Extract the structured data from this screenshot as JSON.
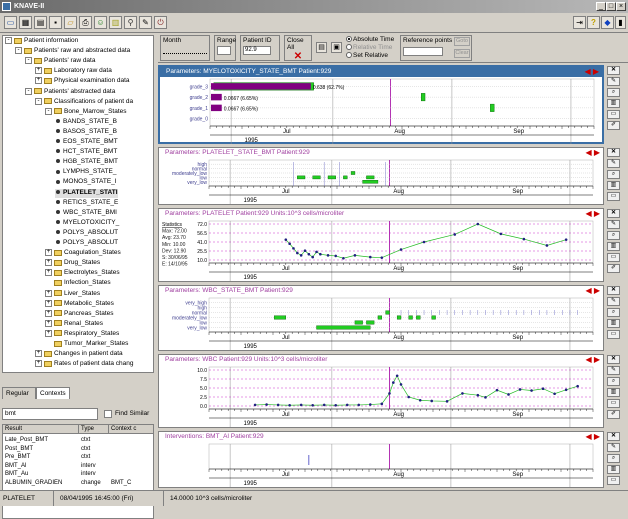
{
  "window": {
    "title": "KNAVE-II"
  },
  "toolbar_icons": [
    "folder-icon",
    "grid-icon",
    "table-icon",
    "save-icon",
    "open-icon",
    "print-icon",
    "person-icon",
    "chart-icon",
    "search-icon",
    "tools-icon",
    "exit-icon"
  ],
  "tree": [
    {
      "level": 0,
      "box": "-",
      "folder": true,
      "label": "Patient information"
    },
    {
      "level": 1,
      "box": "-",
      "folder": true,
      "label": "Patients' raw and abstracted data"
    },
    {
      "level": 2,
      "box": "-",
      "folder": true,
      "label": "Patients' raw data"
    },
    {
      "level": 3,
      "box": "+",
      "folder": true,
      "label": "Laboratory raw data"
    },
    {
      "level": 3,
      "box": "+",
      "folder": true,
      "label": "Physical examination data"
    },
    {
      "level": 2,
      "box": "-",
      "folder": true,
      "label": "Patients' abstracted data"
    },
    {
      "level": 3,
      "box": "-",
      "folder": true,
      "label": "Classifications of patient da"
    },
    {
      "level": 4,
      "box": "-",
      "folder": true,
      "label": "Bone_Marrow_States"
    },
    {
      "level": 5,
      "dot": true,
      "label": "BANDS_STATE_B"
    },
    {
      "level": 5,
      "dot": true,
      "label": "BASOS_STATE_B"
    },
    {
      "level": 5,
      "dot": true,
      "label": "EOS_STATE_BMT"
    },
    {
      "level": 5,
      "dot": true,
      "label": "HCT_STATE_BMT"
    },
    {
      "level": 5,
      "dot": true,
      "label": "HGB_STATE_BMT"
    },
    {
      "level": 5,
      "dot": true,
      "label": "LYMPHS_STATE_"
    },
    {
      "level": 5,
      "dot": true,
      "label": "MONOS_STATE_I"
    },
    {
      "level": 5,
      "dot": true,
      "label": "PLATELET_STATI",
      "selected": true
    },
    {
      "level": 5,
      "dot": true,
      "label": "RETICS_STATE_E"
    },
    {
      "level": 5,
      "dot": true,
      "label": "WBC_STATE_BMI"
    },
    {
      "level": 5,
      "dot": true,
      "label": "MYELOTOXICITY_"
    },
    {
      "level": 5,
      "dot": true,
      "label": "POLYS_ABSOLUT"
    },
    {
      "level": 5,
      "dot": true,
      "label": "POLYS_ABSOLUT"
    },
    {
      "level": 4,
      "box": "+",
      "folder": true,
      "label": "Coagulation_States"
    },
    {
      "level": 4,
      "box": "+",
      "folder": true,
      "label": "Drug_States"
    },
    {
      "level": 4,
      "box": "+",
      "folder": true,
      "label": "Electrolytes_States"
    },
    {
      "level": 4,
      "box": "",
      "folder": true,
      "label": "Infection_States"
    },
    {
      "level": 4,
      "box": "+",
      "folder": true,
      "label": "Liver_States"
    },
    {
      "level": 4,
      "box": "+",
      "folder": true,
      "label": "Metabolic_States"
    },
    {
      "level": 4,
      "box": "+",
      "folder": true,
      "label": "Pancreas_States"
    },
    {
      "level": 4,
      "box": "+",
      "folder": true,
      "label": "Renal_States"
    },
    {
      "level": 4,
      "box": "+",
      "folder": true,
      "label": "Respiratory_States"
    },
    {
      "level": 4,
      "box": "",
      "folder": true,
      "label": "Tumor_Marker_States"
    },
    {
      "level": 3,
      "box": "+",
      "folder": true,
      "label": "Changes in patient data"
    },
    {
      "level": 3,
      "box": "+",
      "folder": true,
      "label": "Rates of patient data chang"
    }
  ],
  "left_tabs": [
    "Regular",
    "Contexts"
  ],
  "search": {
    "value": "bmt",
    "find_similar": "Find Similar"
  },
  "results": {
    "headers": [
      "Result",
      "Type",
      "Context c"
    ],
    "rows": [
      [
        "Late_Post_BMT",
        "ctxt",
        ""
      ],
      [
        "Post_BMT",
        "ctxt",
        ""
      ],
      [
        "Pre_BMT",
        "ctxt",
        ""
      ],
      [
        "BMT_Al",
        "interv",
        ""
      ],
      [
        "BMT_Au",
        "interv",
        ""
      ],
      [
        "ALBUMIN_GRADIEN",
        "change",
        "BMT_C"
      ]
    ]
  },
  "options": {
    "month_label": "Month",
    "range_label": "Range",
    "patient_id_label": "Patient ID",
    "patient_id_value": "92.9",
    "close_all_label": "Close All",
    "absolute_time": "Absolute Time",
    "relative_time": "Relative Time",
    "set_relative": "Set Relative",
    "reference_points": "Reference points",
    "goto_btn": "Goto",
    "clear_btn": "Clear"
  },
  "panels": [
    {
      "title": "Parameters: MYELOTOXICITY_STATE_BMT    Patient:929",
      "active": true,
      "rows": [
        "grade_3",
        "grade_2",
        "grade_1",
        "grade_0"
      ],
      "labels": [
        "0.638 (62.7%)",
        "0.0667 (6.65%)",
        "0.0667 (6.65%)"
      ],
      "year": "1995",
      "months": [
        "Jul",
        "Aug",
        "Sep"
      ]
    },
    {
      "title": "Parameters: PLATELET_STATE_BMT    Patient:929",
      "active": false,
      "rows": [
        "high",
        "normal",
        "moderately_low",
        "low",
        "very_low"
      ],
      "year": "1995",
      "months": [
        "Jul",
        "Aug",
        "Sep"
      ]
    },
    {
      "title": "Parameters: PLATELET    Patient:929    Units:10^3 cells/microliter",
      "active": false,
      "stats": [
        "Statistics",
        "Max: 72.00",
        "Avg: 23.70",
        "Min: 10.00",
        "Dev: 12.90",
        "S: 30/06/95",
        "E: 14/10/95"
      ],
      "yticks": [
        "72.0",
        "56.5",
        "41.0",
        "25.5",
        "10.0"
      ],
      "year": "1995",
      "months": [
        "Jul",
        "Aug",
        "Sep"
      ]
    },
    {
      "title": "Parameters: WBC_STATE_BMT    Patient:929",
      "active": false,
      "rows": [
        "very_high",
        "high",
        "normal",
        "moderately_low",
        "low",
        "very_low"
      ],
      "year": "1995",
      "months": [
        "Jul",
        "Aug",
        "Sep"
      ]
    },
    {
      "title": "Parameters: WBC    Patient:929    Units:10^3 cells/microliter",
      "active": false,
      "yticks": [
        "10.0",
        "7.5",
        "5.0",
        "2.5",
        "0.0"
      ],
      "year": "1995",
      "months": [
        "Jul",
        "Aug",
        "Sep"
      ]
    },
    {
      "title": "Interventions: BMT_Al    Patient:929",
      "active": false,
      "year": "1995",
      "months": [
        "Jul",
        "Aug",
        "Sep"
      ]
    }
  ],
  "status": {
    "param": "PLATELET",
    "datetime": "08/04/1995 16:45:00 (Fri)",
    "value": "14.0000 10^3 cells/microliter"
  },
  "colors": {
    "accent": "#3a6ea5",
    "green": "#22cc22",
    "purple": "#800080",
    "red": "#cc0000",
    "title_text": "#a040a0"
  }
}
